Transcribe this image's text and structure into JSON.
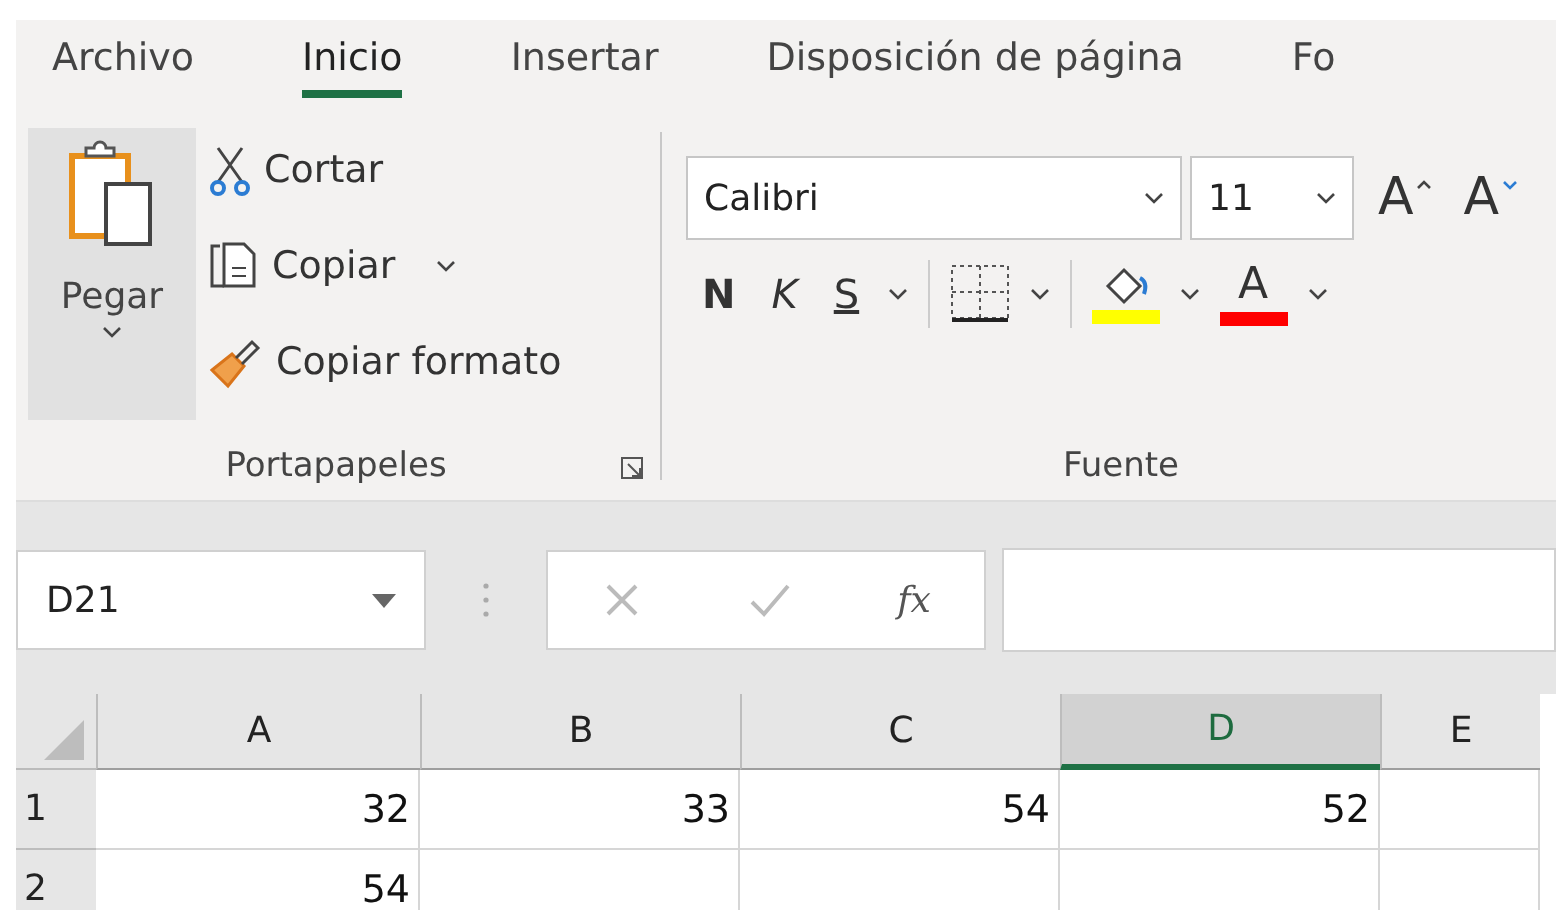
{
  "tabs": [
    {
      "label": "Archivo",
      "selected": false
    },
    {
      "label": "Inicio",
      "selected": true
    },
    {
      "label": "Insertar",
      "selected": false
    },
    {
      "label": "Disposición de página",
      "selected": false
    },
    {
      "label": "Fo",
      "selected": false
    }
  ],
  "clipboard": {
    "paste": "Pegar",
    "cut": "Cortar",
    "copy": "Copiar",
    "format_painter": "Copiar formato",
    "group_label": "Portapapeles"
  },
  "font": {
    "name": "Calibri",
    "size": "11",
    "grow": "A",
    "shrink": "A",
    "bold": "N",
    "italic": "K",
    "underline": "S",
    "color_buttons": [
      {
        "kind": "fill",
        "color": "#ffff00"
      },
      {
        "kind": "font",
        "label": "A",
        "color": "#ff0000"
      }
    ],
    "group_label": "Fuente"
  },
  "formula_bar": {
    "name_box": "D21",
    "function_label": "fx"
  },
  "sheet": {
    "columns": [
      {
        "label": "A",
        "selected": false
      },
      {
        "label": "B",
        "selected": false
      },
      {
        "label": "C",
        "selected": false
      },
      {
        "label": "D",
        "selected": true
      },
      {
        "label": "E",
        "selected": false
      }
    ],
    "rows": [
      {
        "header": "1",
        "cells": [
          "32",
          "33",
          "54",
          "52",
          null
        ]
      },
      {
        "header": "2",
        "cells": [
          "54",
          null,
          null,
          null,
          null
        ]
      }
    ]
  }
}
